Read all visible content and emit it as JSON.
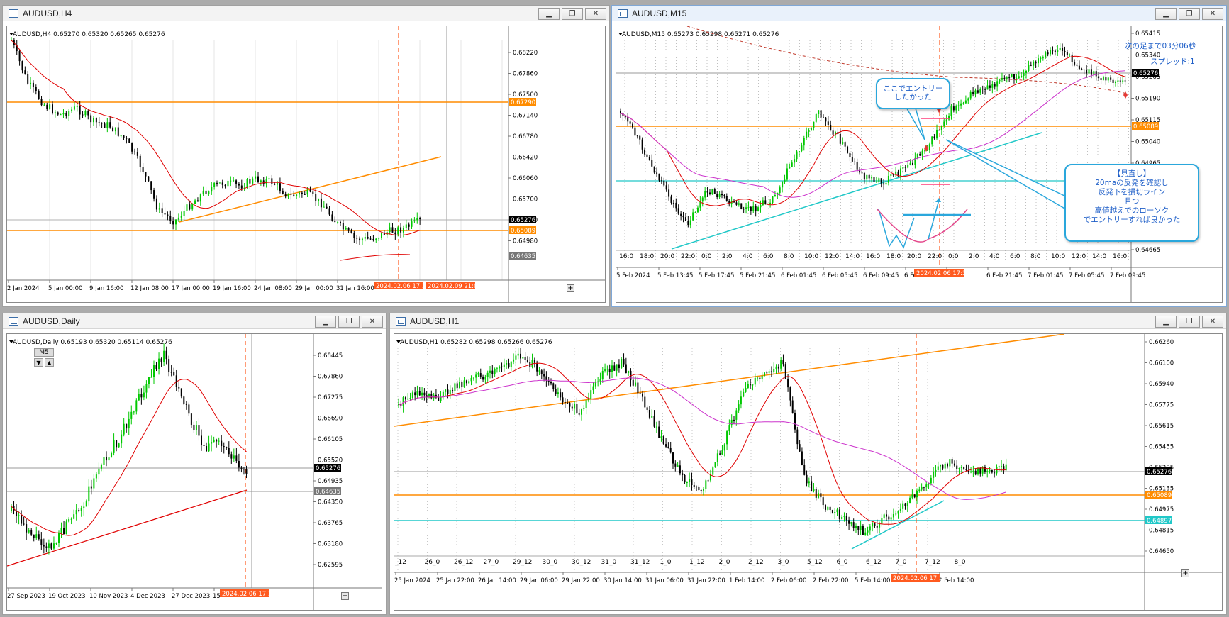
{
  "windows": {
    "h4": {
      "title": "AUDUSD,H4",
      "ohlc": "AUDUSD,H4  0.65270 0.65320 0.65265 0.65276",
      "y_ticks": [
        "0.68220",
        "0.67860",
        "0.67500",
        "0.67140",
        "0.66780",
        "0.66420",
        "0.66060",
        "0.65700",
        "0.65340",
        "0.64980"
      ],
      "price_labels": {
        "current": "0.65276",
        "resistance": "0.67290",
        "support": "0.65089",
        "low": "0.64635"
      },
      "x_ticks": [
        "2 Jan 2024",
        "5 Jan 00:00",
        "9 Jan 16:00",
        "12 Jan 08:00",
        "17 Jan 00:00",
        "19 Jan 16:00",
        "24 Jan 08:00",
        "29 Jan 00:00",
        "31 Jan 16:00"
      ],
      "x_highlights": [
        "2024.02.06 17:30",
        "2024.02.09 21:00"
      ]
    },
    "m15": {
      "title": "AUDUSD,M15",
      "ohlc": "AUDUSD,M15  0.65273 0.65298 0.65271 0.65276",
      "y_ticks": [
        "0.65415",
        "0.65340",
        "0.65265",
        "0.65190",
        "0.65115",
        "0.65040",
        "0.64965",
        "0.64890",
        "0.64815",
        "0.64740",
        "0.64665"
      ],
      "price_labels": {
        "current": "0.65276",
        "support": "0.65089"
      },
      "hour_ticks": [
        "16:0",
        "18:0",
        "20:0",
        "22:0",
        "0:0",
        "2:0",
        "4:0",
        "6:0",
        "8:0",
        "10:0",
        "12:0",
        "14:0",
        "16:0",
        "18:0",
        "20:0",
        "22:0",
        "0:0",
        "2:0",
        "4:0",
        "6:0",
        "8:0",
        "10:0",
        "12:0",
        "14:0",
        "16:0"
      ],
      "x_ticks": [
        "5 Feb 2024",
        "5 Feb 13:45",
        "5 Feb 17:45",
        "5 Feb 21:45",
        "6 Feb 01:45",
        "6 Feb 05:45",
        "6 Feb 09:45",
        "6 Fe",
        "45",
        "6 Feb 21:45",
        "7 Feb 01:45",
        "7 Feb 05:45",
        "7 Feb 09:45"
      ],
      "x_highlight": "2024.02.06 17:30",
      "countdown": "次の足まで03分06秒",
      "spread": "スプレッド:1",
      "bubble1": [
        "ここでエントリー",
        "したかった"
      ],
      "bubble2": [
        "【見直し】",
        "20maの反発を確認し",
        "反発下を損切ライン",
        "且つ",
        "高値越えでのローソク",
        "でエントリーすれば良かった"
      ]
    },
    "daily": {
      "title": "AUDUSD,Daily",
      "ohlc": "AUDUSD,Daily  0.65193 0.65320 0.65114 0.65276",
      "tf_box": "M5",
      "y_ticks": [
        "0.68445",
        "0.67860",
        "0.67275",
        "0.66690",
        "0.66105",
        "0.65520",
        "0.64935",
        "0.64350",
        "0.63765",
        "0.63180",
        "0.62595"
      ],
      "price_labels": {
        "current": "0.65276",
        "low": "0.64635"
      },
      "x_ticks": [
        "27 Sep 2023",
        "19 Oct 2023",
        "10 Nov 2023",
        "4 Dec 2023",
        "27 Dec 2023",
        "15"
      ],
      "x_highlight": "2024.02.06 17:30"
    },
    "h1": {
      "title": "AUDUSD,H1",
      "ohlc": "AUDUSD,H1  0.65282 0.65298 0.65266 0.65276",
      "y_ticks": [
        "0.66260",
        "0.66100",
        "0.65940",
        "0.65775",
        "0.65615",
        "0.65455",
        "0.65295",
        "0.65135",
        "0.64975",
        "0.64815",
        "0.64650"
      ],
      "price_labels": {
        "current": "0.65276",
        "support": "0.65089",
        "band": "0.64897"
      },
      "grid_labels": [
        "_12",
        "26_0",
        "26_12",
        "27_0",
        "29_12",
        "30_0",
        "30_12",
        "31_0",
        "31_12",
        "1_0",
        "1_12",
        "2_0",
        "2_12",
        "3_0",
        "5_12",
        "6_0",
        "6_12",
        "7_0",
        "7_12",
        "8_0"
      ],
      "x_ticks": [
        "25 Jan 2024",
        "25 Jan 22:00",
        "26 Jan 14:00",
        "29 Jan 06:00",
        "29 Jan 22:00",
        "30 Jan 14:00",
        "31 Jan 06:00",
        "31 Jan 22:00",
        "1 Feb 14:00",
        "2 Feb 06:00",
        "2 Feb 22:00",
        "5 Feb 14:00",
        "22:00",
        "7 Feb 14:00"
      ],
      "x_highlight": "2024.02.06 17:30"
    }
  },
  "icons": {
    "minimize": "minimize-icon",
    "maximize": "maximize-icon",
    "close": "close-icon"
  },
  "colors": {
    "candle_up": "#00c800",
    "candle_down": "#000000",
    "ma": "#e00000",
    "ma_long": "#cc33cc",
    "support_line": "#ff8c00",
    "trend_line": "#20c8c8",
    "entry_line": "#ff5a1f",
    "highlight": "#ff5a1f"
  }
}
